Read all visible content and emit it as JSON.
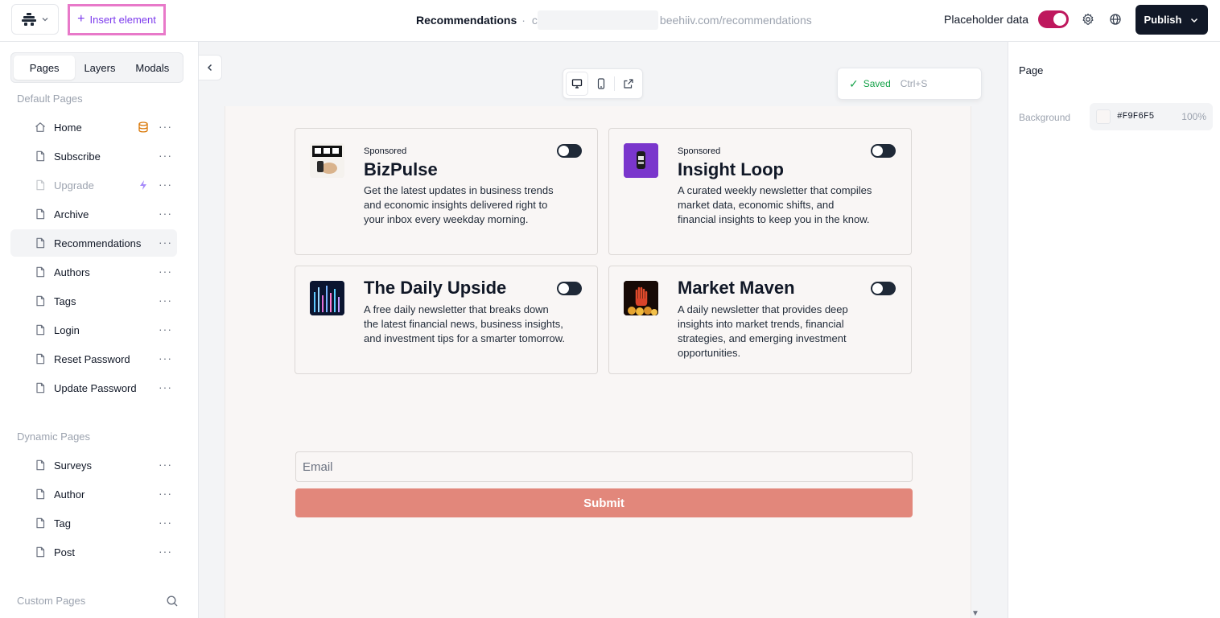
{
  "topbar": {
    "insert_label": "Insert element",
    "page_title": "Recommendations",
    "separator": "·",
    "url_prefix": "c",
    "url_text": "beehiiv.com/recommendations",
    "placeholder_label": "Placeholder data",
    "placeholder_enabled": true,
    "publish_label": "Publish",
    "accent_color": "#be185d"
  },
  "sidebar": {
    "tabs": [
      {
        "label": "Pages",
        "active": true
      },
      {
        "label": "Layers",
        "active": false
      },
      {
        "label": "Modals",
        "active": false
      }
    ],
    "default_heading": "Default Pages",
    "default_pages": [
      {
        "label": "Home",
        "icon": "home-icon",
        "badge": "database-icon"
      },
      {
        "label": "Subscribe",
        "icon": "file-icon"
      },
      {
        "label": "Upgrade",
        "icon": "file-icon",
        "badge": "lightning-icon",
        "muted": true
      },
      {
        "label": "Archive",
        "icon": "file-icon"
      },
      {
        "label": "Recommendations",
        "icon": "file-icon",
        "active": true
      },
      {
        "label": "Authors",
        "icon": "file-icon"
      },
      {
        "label": "Tags",
        "icon": "file-icon"
      },
      {
        "label": "Login",
        "icon": "file-icon"
      },
      {
        "label": "Reset Password",
        "icon": "file-icon"
      },
      {
        "label": "Update Password",
        "icon": "file-icon"
      }
    ],
    "dynamic_heading": "Dynamic Pages",
    "dynamic_pages": [
      {
        "label": "Surveys"
      },
      {
        "label": "Author"
      },
      {
        "label": "Tag"
      },
      {
        "label": "Post"
      }
    ],
    "custom_heading": "Custom Pages"
  },
  "canvas": {
    "saved_label": "Saved",
    "shortcut": "Ctrl+S",
    "recommendations": [
      {
        "sponsored": "Sponsored",
        "title": "BizPulse",
        "description": "Get the latest updates in business trends and economic insights delivered right to your inbox every weekday morning."
      },
      {
        "sponsored": "Sponsored",
        "title": "Insight Loop",
        "description": "A curated weekly newsletter that compiles market data, economic shifts, and financial insights to keep you in the know."
      },
      {
        "sponsored": "",
        "title": "The Daily Upside",
        "description": "A free daily newsletter that breaks down the latest financial news, business insights, and investment tips for a smarter tomorrow."
      },
      {
        "sponsored": "",
        "title": "Market Maven",
        "description": "A daily newsletter that provides deep insights into market trends, financial strategies, and emerging investment opportunities."
      }
    ],
    "email_placeholder": "Email",
    "submit_label": "Submit",
    "submit_color": "#e2877b"
  },
  "rightpanel": {
    "title": "Page",
    "background_label": "Background",
    "background_hex": "#F9F6F5",
    "background_opacity": "100%"
  }
}
